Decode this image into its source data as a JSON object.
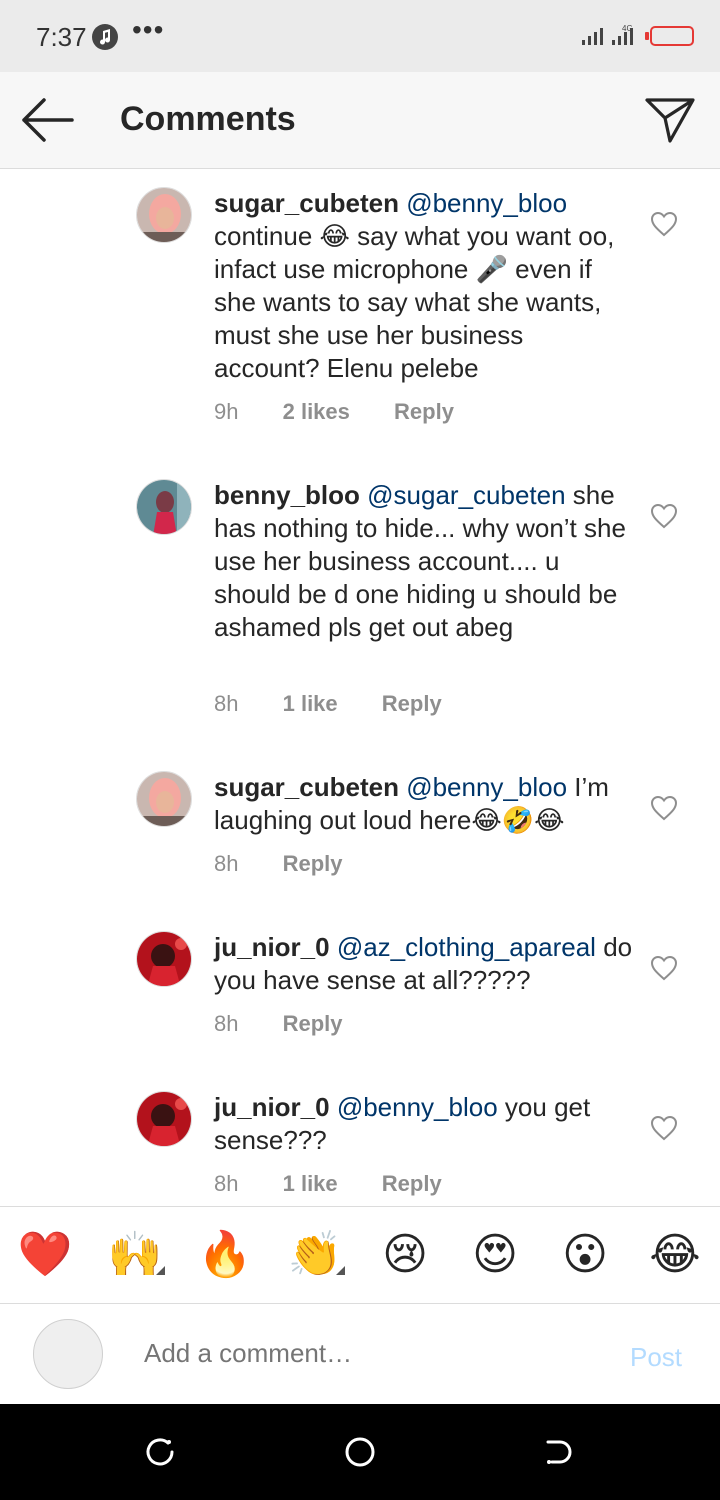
{
  "status_bar": {
    "time": "7:37",
    "more": "•••",
    "network": "4G"
  },
  "header": {
    "title": "Comments"
  },
  "comments": [
    {
      "username": "sugar_cubeten",
      "mention": "@benny_bloo",
      "text": "continue 😂  say what you want oo, infact use microphone 🎤 even if she wants to say what she wants, must she use her business account? Elenu pelebe",
      "time": "9h",
      "likes": "2 likes",
      "reply": "Reply"
    },
    {
      "username": "benny_bloo",
      "mention": "@sugar_cubeten",
      "text": "she has nothing to hide... why won’t she use her business account.... u should be d one hiding u should be ashamed pls get out abeg",
      "time": "8h",
      "likes": "1 like",
      "reply": "Reply"
    },
    {
      "username": "sugar_cubeten",
      "mention": "@benny_bloo",
      "text": " I’m laughing out loud here😂🤣😂",
      "time": "8h",
      "likes": "",
      "reply": "Reply"
    },
    {
      "username": "ju_nior_0",
      "mention": "@az_clothing_apareal",
      "text": "do you have sense at all?????",
      "time": "8h",
      "likes": "",
      "reply": "Reply"
    },
    {
      "username": "ju_nior_0",
      "mention": "@benny_bloo",
      "text": "you get sense???",
      "time": "8h",
      "likes": "1 like",
      "reply": "Reply"
    }
  ],
  "emoji_bar": [
    "❤️",
    "🙌",
    "🔥",
    "👏",
    "😢",
    "😍",
    "😮",
    "😂"
  ],
  "compose": {
    "placeholder": "Add a comment…",
    "post_label": "Post"
  },
  "colors": {
    "mention": "#003569",
    "post_disabled": "#b3dbff",
    "meta": "#8e8e8e"
  }
}
